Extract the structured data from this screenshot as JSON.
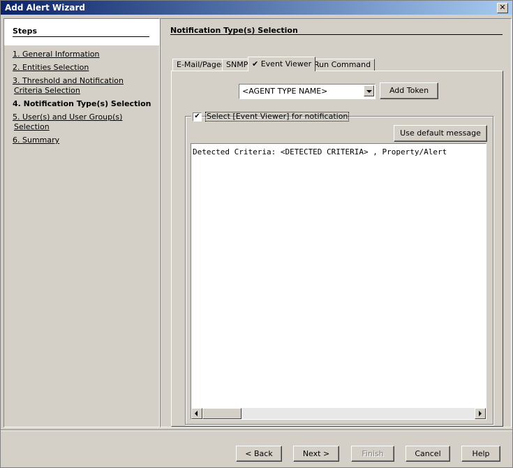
{
  "window": {
    "title": "Add Alert Wizard",
    "close_symbol": "✕"
  },
  "steps": {
    "header": "Steps",
    "items": [
      {
        "label": "1. General Information"
      },
      {
        "label": "2. Entities Selection"
      },
      {
        "label": "3. Threshold and Notification"
      },
      {
        "label": "Criteria Selection"
      },
      {
        "label": "4. Notification Type(s) Selection"
      },
      {
        "label": "5. User(s) and User Group(s)"
      },
      {
        "label": "Selection"
      },
      {
        "label": "6. Summary"
      }
    ]
  },
  "main": {
    "section_title": "Notification Type(s) Selection",
    "tabs": [
      {
        "label": "E-Mail/Pager"
      },
      {
        "label": "SNMP"
      },
      {
        "label": "✔ Event Viewer"
      },
      {
        "label": "Run Command"
      }
    ],
    "token_combo": {
      "value": "<AGENT TYPE NAME>"
    },
    "add_token_label": "Add Token",
    "notify_checkbox": {
      "checked_symbol": "✔",
      "label": "Select [Event Viewer] for  notification"
    },
    "use_default_label": "Use default message",
    "message_text": "Detected Criteria: <DETECTED CRITERIA> , Property/Alert"
  },
  "footer": {
    "back_label": "< Back",
    "next_label": "Next >",
    "finish_label": "Finish",
    "cancel_label": "Cancel",
    "help_label": "Help"
  }
}
